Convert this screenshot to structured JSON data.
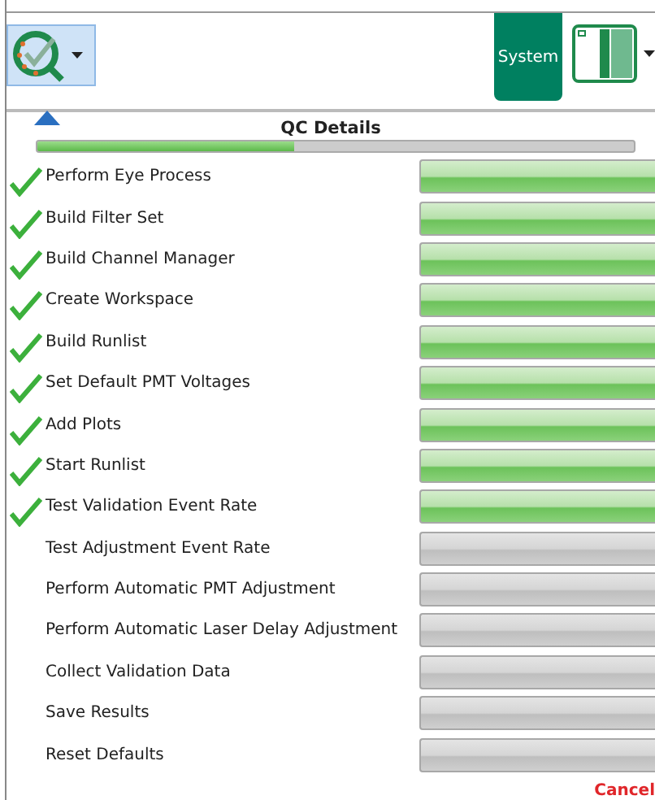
{
  "toolbar": {
    "app_menu": {
      "selected": true
    },
    "system_button": "System"
  },
  "qc_details": {
    "title": "QC Details",
    "overall_progress": {
      "level": 0.43
    },
    "steps": [
      {
        "label": "Perform Eye Process",
        "completed": true
      },
      {
        "label": "Build Filter Set",
        "completed": true
      },
      {
        "label": "Build Channel Manager",
        "completed": true
      },
      {
        "label": "Create Workspace",
        "completed": true
      },
      {
        "label": "Build Runlist",
        "completed": true
      },
      {
        "label": "Set Default PMT Voltages",
        "completed": true
      },
      {
        "label": "Add Plots",
        "completed": true
      },
      {
        "label": "Start Runlist",
        "completed": true
      },
      {
        "label": "Test Validation Event Rate",
        "completed": true
      },
      {
        "label": "Test Adjustment Event Rate",
        "completed": false
      },
      {
        "label": "Perform Automatic PMT Adjustment",
        "completed": false
      },
      {
        "label": "Perform Automatic Laser Delay Adjustment",
        "completed": false
      },
      {
        "label": "Collect Validation Data",
        "completed": false
      },
      {
        "label": "Save Results",
        "completed": false
      },
      {
        "label": "Reset Defaults",
        "completed": false
      }
    ],
    "cancel": "Cancel"
  }
}
